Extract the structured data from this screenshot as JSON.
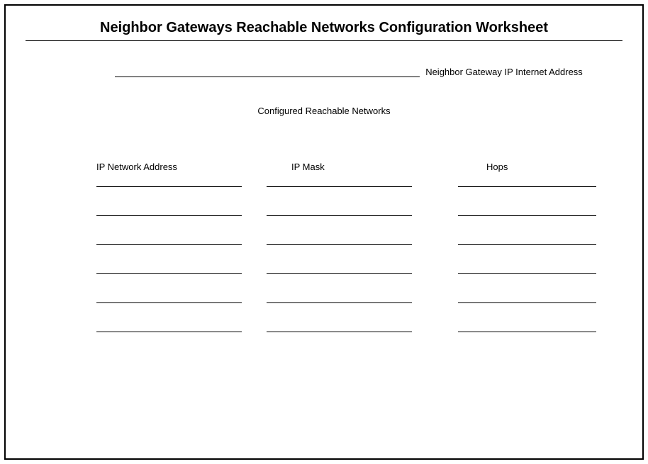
{
  "title": "Neighbor Gateways Reachable Networks Configuration Worksheet",
  "gateway_label": "Neighbor Gateway IP Internet Address",
  "subtitle": "Configured Reachable Networks",
  "columns": {
    "ip_network_address": "IP Network Address",
    "ip_mask": "IP Mask",
    "hops": "Hops"
  },
  "row_count": 6
}
